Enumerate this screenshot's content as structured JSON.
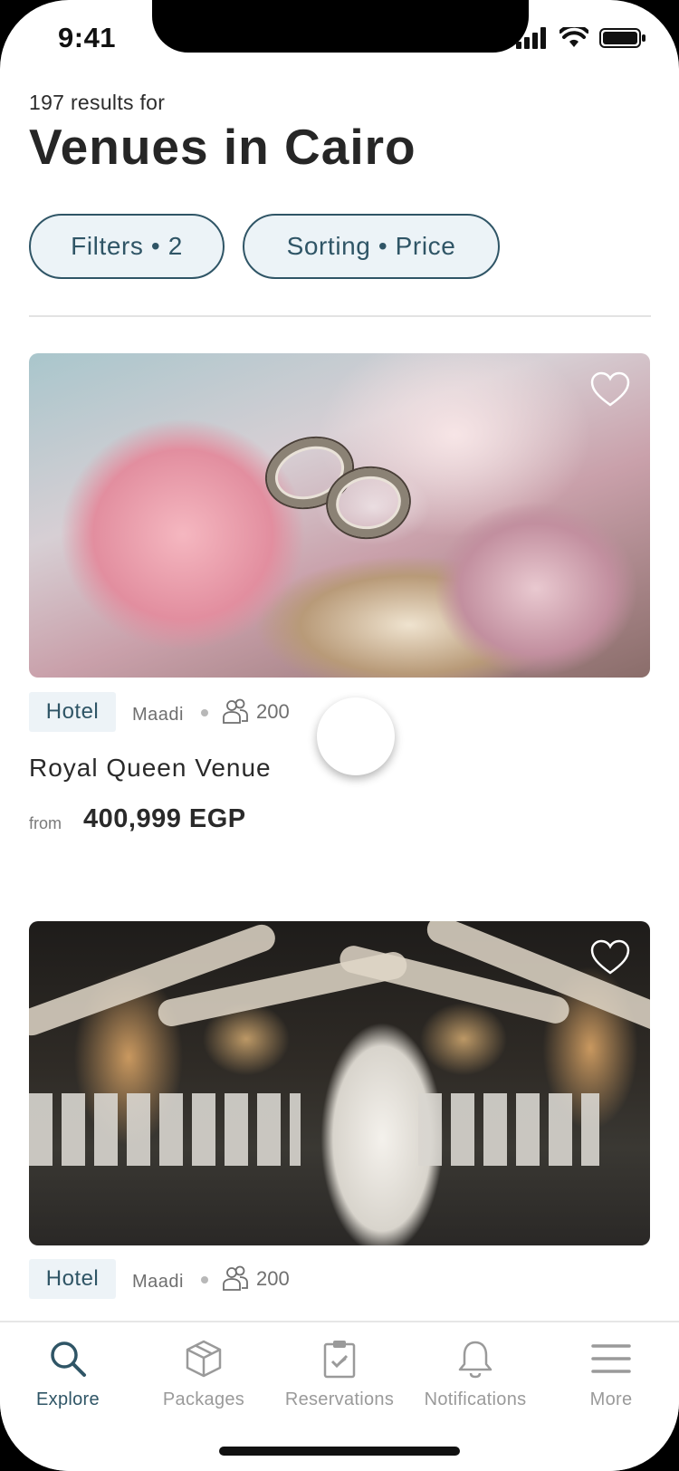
{
  "status_bar": {
    "time": "9:41"
  },
  "header": {
    "results_count": "197 results for",
    "title": "Venues in Cairo"
  },
  "chips": {
    "filters": "Filters • 2",
    "sorting": "Sorting • Price"
  },
  "venues": [
    {
      "tag": "Hotel",
      "location": "Maadi",
      "guests": "200",
      "name": "Royal Queen Venue",
      "price_prefix": "from",
      "price": "400,999 EGP",
      "image": "wedding-rings-flowers-photo"
    },
    {
      "tag": "Hotel",
      "location": "Maadi",
      "guests": "200",
      "image": "wedding-couple-ceremony-photo"
    }
  ],
  "tabs": [
    {
      "label": "Explore",
      "icon": "search-icon",
      "active": true
    },
    {
      "label": "Packages",
      "icon": "package-icon",
      "active": false
    },
    {
      "label": "Reservations",
      "icon": "clipboard-icon",
      "active": false
    },
    {
      "label": "Notifications",
      "icon": "bell-icon",
      "active": false
    },
    {
      "label": "More",
      "icon": "menu-icon",
      "active": false
    }
  ],
  "colors": {
    "accent": "#2f5566",
    "chip_bg": "#ecf3f7",
    "inactive": "#9a9a9a"
  }
}
